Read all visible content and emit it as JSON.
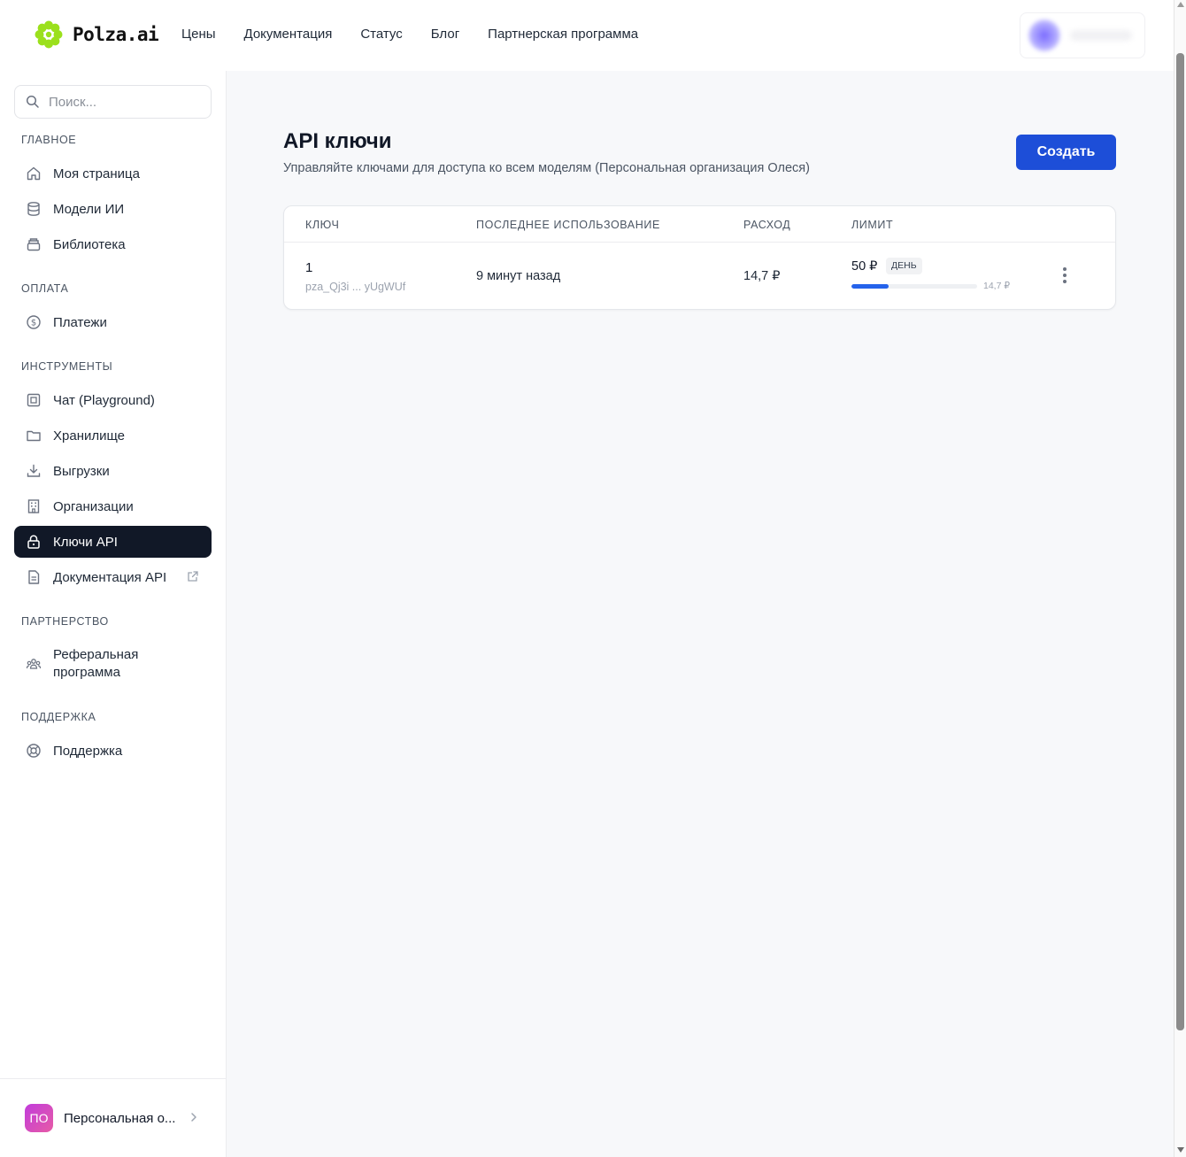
{
  "header": {
    "brand": "Polza.ai",
    "nav": [
      {
        "label": "Цены"
      },
      {
        "label": "Документация"
      },
      {
        "label": "Статус"
      },
      {
        "label": "Блог"
      },
      {
        "label": "Партнерская программа"
      }
    ]
  },
  "sidebar": {
    "search_placeholder": "Поиск...",
    "sections": {
      "main": "ГЛАВНОЕ",
      "payment": "ОПЛАТА",
      "tools": "ИНСТРУМЕНТЫ",
      "partnership": "ПАРТНЕРСТВО",
      "support": "ПОДДЕРЖКА"
    },
    "items": {
      "my_page": "Моя страница",
      "ai_models": "Модели ИИ",
      "library": "Библиотека",
      "payments": "Платежи",
      "chat": "Чат (Playground)",
      "storage": "Хранилище",
      "exports": "Выгрузки",
      "organizations": "Организации",
      "api_keys": "Ключи API",
      "api_docs": "Документация API",
      "referral": "Реферальная программа",
      "support": "Поддержка"
    },
    "active_item": "api_keys",
    "org": {
      "initials": "ПО",
      "name": "Персональная о..."
    }
  },
  "main": {
    "title": "API ключи",
    "subtitle": "Управляйте ключами для доступа ко всем моделям (Персональная организация Олеся)",
    "create_label": "Создать",
    "table": {
      "columns": {
        "key": "КЛЮЧ",
        "last_used": "ПОСЛЕДНЕЕ ИСПОЛЬЗОВАНИЕ",
        "spend": "РАСХОД",
        "limit": "ЛИМИТ"
      },
      "rows": [
        {
          "name": "1",
          "masked_key": "pza_Qj3i ... yUgWUf",
          "last_used": "9 минут назад",
          "spend": "14,7 ₽",
          "limit": "50 ₽",
          "limit_period": "ДЕНЬ",
          "limit_used": "14,7 ₽",
          "limit_fraction": 0.294
        }
      ]
    }
  },
  "colors": {
    "accent": "#1d4ed8",
    "active_nav_bg": "#111827",
    "progress": "#2563eb",
    "main_bg": "#f7f8fa"
  }
}
